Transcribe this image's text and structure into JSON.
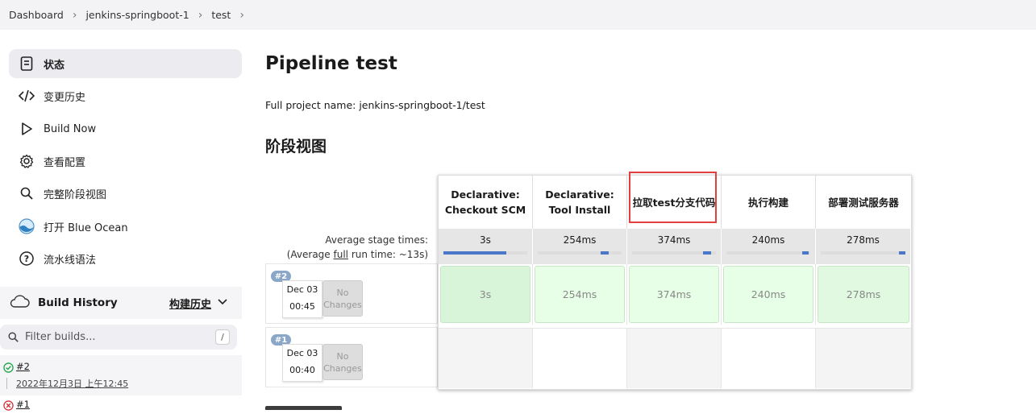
{
  "breadcrumb": [
    "Dashboard",
    "jenkins-springboot-1",
    "test"
  ],
  "sidebar": {
    "tasks": [
      {
        "label": "状态",
        "icon": "document-icon"
      },
      {
        "label": "变更历史",
        "icon": "code-icon"
      },
      {
        "label": "Build Now",
        "icon": "play-icon"
      },
      {
        "label": "查看配置",
        "icon": "gear-icon"
      },
      {
        "label": "完整阶段视图",
        "icon": "search-icon"
      },
      {
        "label": "打开 Blue Ocean",
        "icon": "blue-ocean-icon"
      },
      {
        "label": "流水线语法",
        "icon": "help-icon"
      }
    ],
    "build_history": {
      "title": "Build History",
      "link": "构建历史"
    },
    "filter_placeholder": "Filter builds...",
    "filter_shortcut": "/",
    "builds": [
      {
        "number": "#2",
        "status": "success",
        "date": "2022年12月3日 上午12:45"
      },
      {
        "number": "#1",
        "status": "failed"
      }
    ]
  },
  "main": {
    "title": "Pipeline test",
    "full_name": "Full project name: jenkins-springboot-1/test",
    "stage_view_title": "阶段视图",
    "avg_label_1": "Average stage times:",
    "avg_label_2": "(Average ",
    "avg_label_full": "full",
    "avg_label_3": " run time: ~13s)",
    "stages": [
      {
        "name": "Declarative: Checkout SCM",
        "avg": "3s",
        "avg_share": 0.75
      },
      {
        "name": "Declarative: Tool Install",
        "avg": "254ms",
        "avg_share": 0.1
      },
      {
        "name": "拉取test分支代码",
        "avg": "374ms",
        "avg_share": 0.1
      },
      {
        "name": "执行构建",
        "avg": "240ms",
        "avg_share": 0.08
      },
      {
        "name": "部署测试服务器",
        "avg": "278ms",
        "avg_share": 0.08
      }
    ],
    "runs": [
      {
        "badge": "#2",
        "date": "Dec 03",
        "time": "00:45",
        "changes": "No Changes",
        "cells": [
          "3s",
          "254ms",
          "374ms",
          "240ms",
          "278ms"
        ]
      },
      {
        "badge": "#1",
        "date": "Dec 03",
        "time": "00:40",
        "changes": "No Changes",
        "cells": [
          "",
          "",
          "",
          "",
          ""
        ]
      }
    ]
  }
}
